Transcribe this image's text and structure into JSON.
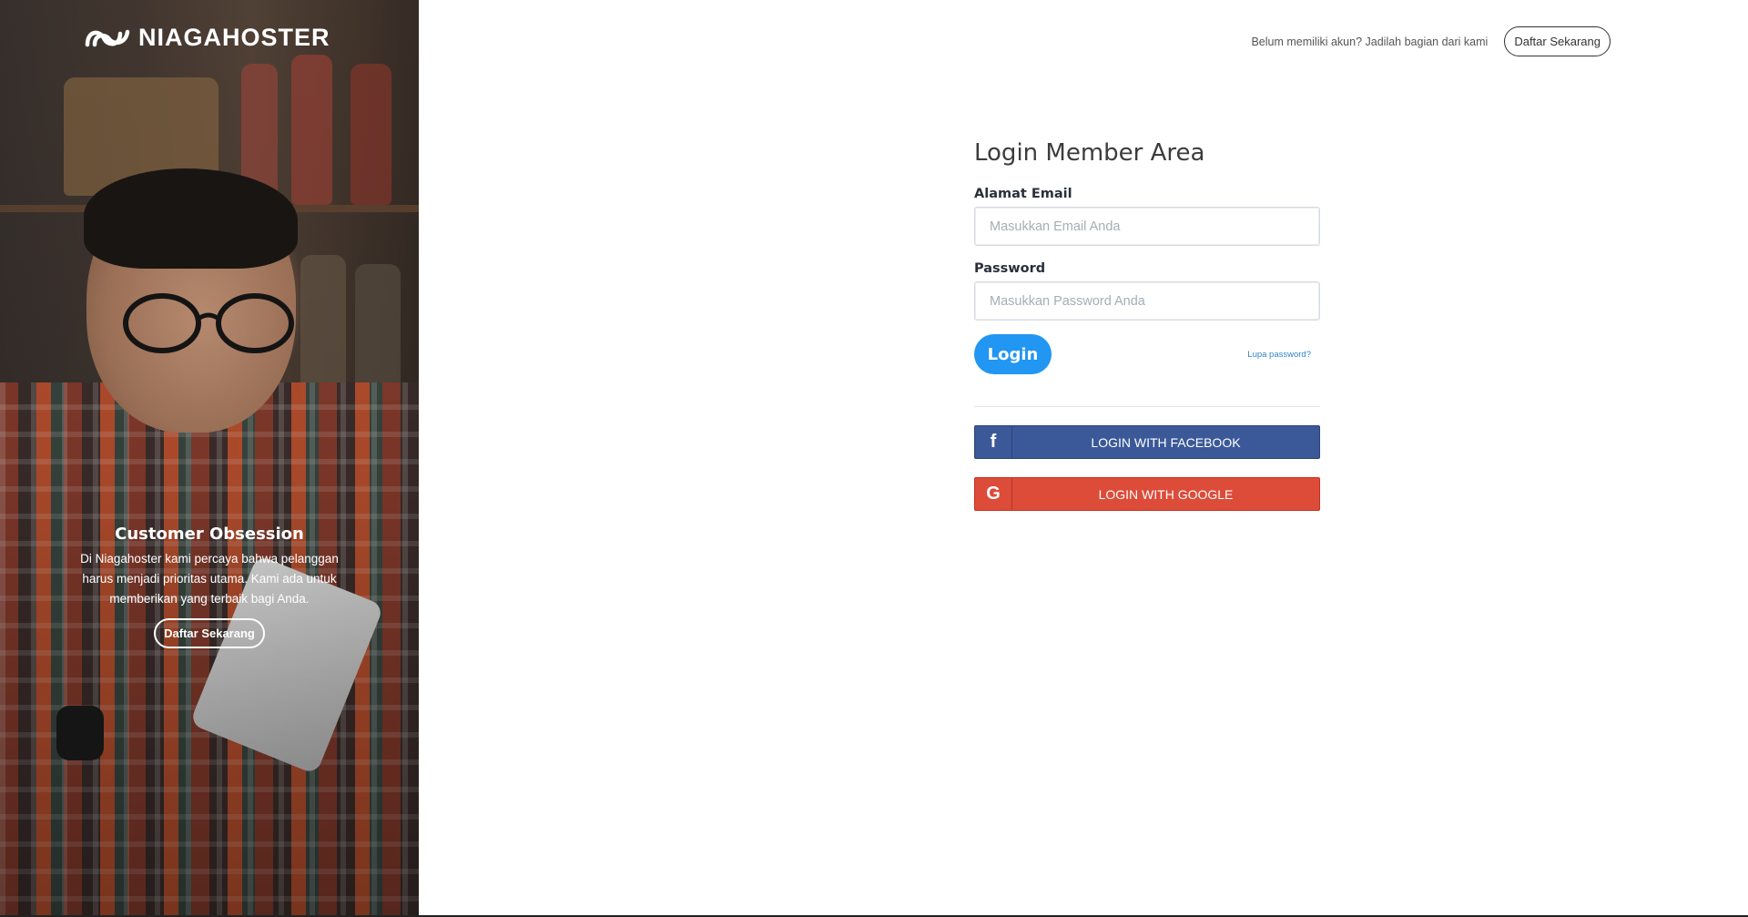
{
  "brand": {
    "name": "NIAGAHOSTER"
  },
  "hero": {
    "title": "Customer Obsession",
    "text": "Di Niagahoster kami percaya bahwa pelanggan harus menjadi prioritas utama. Kami ada untuk memberikan yang terbaik bagi Anda.",
    "cta_label": "Daftar Sekarang"
  },
  "topbar": {
    "prompt": "Belum memiliki akun? Jadilah bagian dari kami",
    "signup_label": "Daftar Sekarang"
  },
  "form": {
    "title": "Login Member Area",
    "email_label": "Alamat Email",
    "email_placeholder": "Masukkan Email Anda",
    "email_value": "",
    "password_label": "Password",
    "password_placeholder": "Masukkan Password Anda",
    "password_value": "",
    "login_label": "Login",
    "forgot_label": "Lupa password?"
  },
  "social": {
    "facebook": {
      "icon": "facebook-icon",
      "glyph": "f",
      "label": "LOGIN WITH FACEBOOK",
      "color": "#3b5998"
    },
    "google": {
      "icon": "google-icon",
      "glyph": "G",
      "label": "LOGIN WITH GOOGLE",
      "color": "#dd4b39"
    }
  },
  "colors": {
    "primary": "#2196f3",
    "link": "#2f86c6"
  }
}
